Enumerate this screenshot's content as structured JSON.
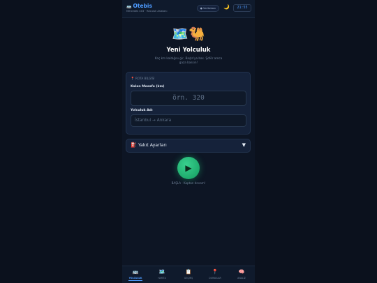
{
  "header": {
    "brand_icon": "🚌",
    "brand": "Otebis",
    "subtitle": "Mercedes 403 · Yolculuk Asistanı",
    "status_badge": "● Veritabanı",
    "theme_icon": "🌙",
    "clock": "21:55"
  },
  "hero": {
    "icons": "🗺️🐫",
    "title": "Yeni Yolculuk",
    "description": "Kaç km kaldığını gir, Başla'ya bas. Şoför amca gaza bassın!"
  },
  "route_card": {
    "section_icon": "📍",
    "section_title": "ROTA BİLGİSİ",
    "distance_label": "Kalan Mesafe (km)",
    "distance_placeholder": "örn. 320",
    "name_label": "Yolculuk Adı",
    "name_placeholder": "İstanbul → Ankara"
  },
  "fuel": {
    "icon": "⛽",
    "label": "Yakıt Ayarları",
    "caret": "▼"
  },
  "start": {
    "icon": "▶",
    "label": "BAŞLA · Kaptan devam!"
  },
  "nav": [
    {
      "icon": "🚌",
      "label": "YOLCULUK",
      "active": true
    },
    {
      "icon": "🗺️",
      "label": "HARİTA",
      "active": false
    },
    {
      "icon": "📋",
      "label": "GEÇMİŞ",
      "active": false
    },
    {
      "icon": "📍",
      "label": "DURAKLAR",
      "active": false
    },
    {
      "icon": "🧠",
      "label": "ANALİZ",
      "active": false
    }
  ],
  "colors": {
    "background": "#0b111d",
    "accent": "#4d9bff",
    "start_green": "#1fc478",
    "card": "#15223a"
  }
}
